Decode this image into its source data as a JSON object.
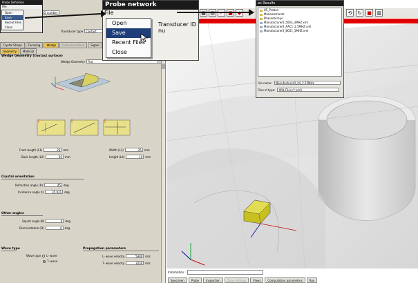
{
  "tiny_window": {
    "title": "Probe Definition",
    "menu_label": "File",
    "menu_items": [
      "Open",
      "Save",
      "Recent Files",
      "Close"
    ],
    "selected_index": 1
  },
  "left_panel": {
    "transducer_id_label": "Transducer ID number",
    "transducer_type_label": "Transducer type",
    "transducer_type_value": "Contact",
    "tabs_row1": [
      "Crystal Shape",
      "Focusing",
      "Wedge",
      "Instrumentation",
      "Signal"
    ],
    "tabs_row1_active": 2,
    "tabs_row2": [
      "Geometry",
      "Material"
    ],
    "tabs_row2_active": 0,
    "wedge_geometry_heading": "Wedge Geometry (contact surface)",
    "wedge_geometry_label": "Wedge Geometry",
    "wedge_geometry_value": "Flat",
    "front_length_label": "Front length (L1)",
    "front_length_value": "20",
    "back_length_label": "Back length (L2)",
    "back_length_value": "20",
    "width_label": "Width (L3)",
    "width_value": "25",
    "height_label": "Height (L4)",
    "height_value": "10",
    "unit_mm": "mm",
    "crystal_orientation_heading": "Crystal orientation",
    "refraction_label": "Refraction angle (R)",
    "refraction_value": "45",
    "incidence_label": "Incidence angle (I)",
    "incidence_value": "35.921",
    "unit_deg": "deg",
    "other_angles_heading": "Other angles",
    "squint_label": "Squint angle (B)",
    "squint_value": "0",
    "disorientation_label": "Disorientation (D)",
    "disorientation_value": "0",
    "wave_type_heading": "Wave type",
    "wave_type_label": "Wave type",
    "l_wave_label": "L- wave",
    "t_wave_label": "T- wave",
    "propagation_heading": "Propagation parameters",
    "l_velocity_label": "L- wave velocity",
    "l_velocity_value": "5900",
    "t_velocity_label": "T- wave velocity",
    "t_velocity_value": "3230",
    "velocity_unit": "m/s"
  },
  "big_window": {
    "title": "Probe network",
    "menu_label": "File",
    "menu_items": [
      "Open",
      "Save",
      "Recent Files",
      "Close"
    ],
    "selected_index": 1,
    "background_label": "Transducer ID nu"
  },
  "file_dialog": {
    "title": "es Results",
    "items": [
      "US_Probes",
      "Monoelements",
      "Phasedarrays",
      "Manufacturer0_5003_3MHZ.xml",
      "Manufacturer0_AAC1_2.5MHZ.xml",
      "Manufacturer0_BC01_5MHZ.xml"
    ],
    "file_name_label": "File name:",
    "file_name_value": "Manufacturer0_44_2.25MHz",
    "files_of_type_label": "Files of type:",
    "files_of_type_value": "XML Files (*.xml)"
  },
  "toolbar": {
    "left_icons": [
      "grid-icon",
      "table-icon",
      "cursor-icon",
      "cube-icon",
      "red-cube-icon"
    ],
    "right_icons": [
      "reset-view-icon",
      "refresh-icon",
      "stop-icon",
      "layers-icon"
    ]
  },
  "bottom": {
    "information_label": "Information :",
    "tabs": [
      "Specimen",
      "Probe",
      "Inspection",
      "Zone settings",
      "Flaws",
      "Computation parameters",
      "Run"
    ],
    "dim_tabs": [
      3
    ]
  },
  "colors": {
    "accent_tab": "#e8c35a",
    "red_strip": "#e00000",
    "menu_selection": "#1f3f7a",
    "probe_yellow": "#c8c020"
  }
}
